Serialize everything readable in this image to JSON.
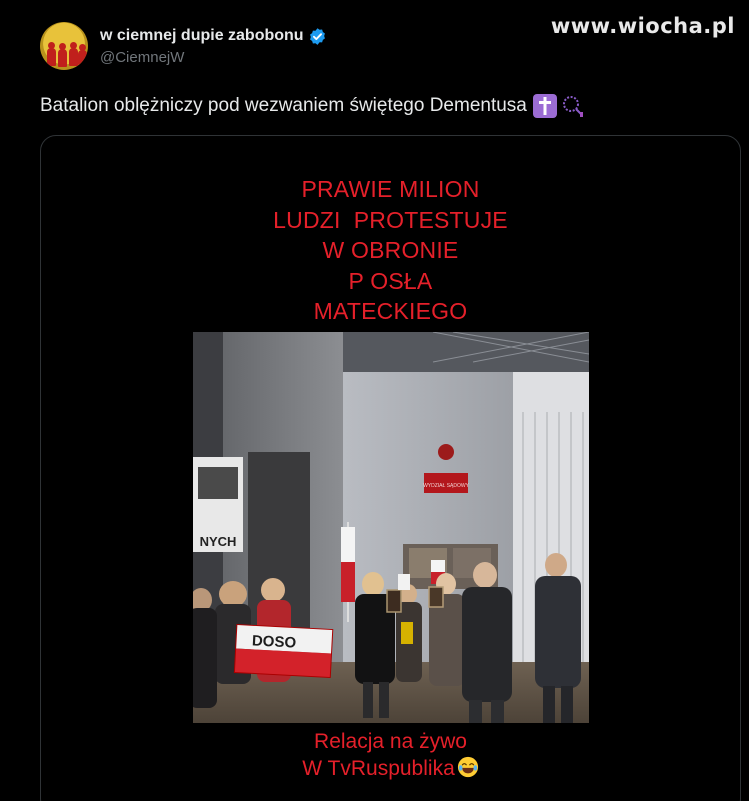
{
  "watermark": "www.wiocha.pl",
  "author": {
    "display_name": "w ciemnej dupie zabobonu",
    "handle": "@CiemnejW",
    "verified": true,
    "avatar_icon": "avatar-icon"
  },
  "tweet": {
    "text": "Batalion oblężniczy pod wezwaniem świętego Dementusa",
    "emojis": [
      "latin-cross-icon",
      "rosary-icon"
    ]
  },
  "media": {
    "overlay_top": [
      "PRAWIE MILION",
      "LUDZI  PROTESTUJE",
      "W OBRONIE",
      "P OSŁA",
      "MATECKIEGO"
    ],
    "overlay_bottom_line1": "Relacja na żywo",
    "overlay_bottom_line2": "W TvRuspublika",
    "banner_text": "DOSO",
    "sign_text": "NYCH",
    "plaque_text": "WYDZIAŁ SĄDOWY",
    "accent_color": "#e5202a"
  }
}
